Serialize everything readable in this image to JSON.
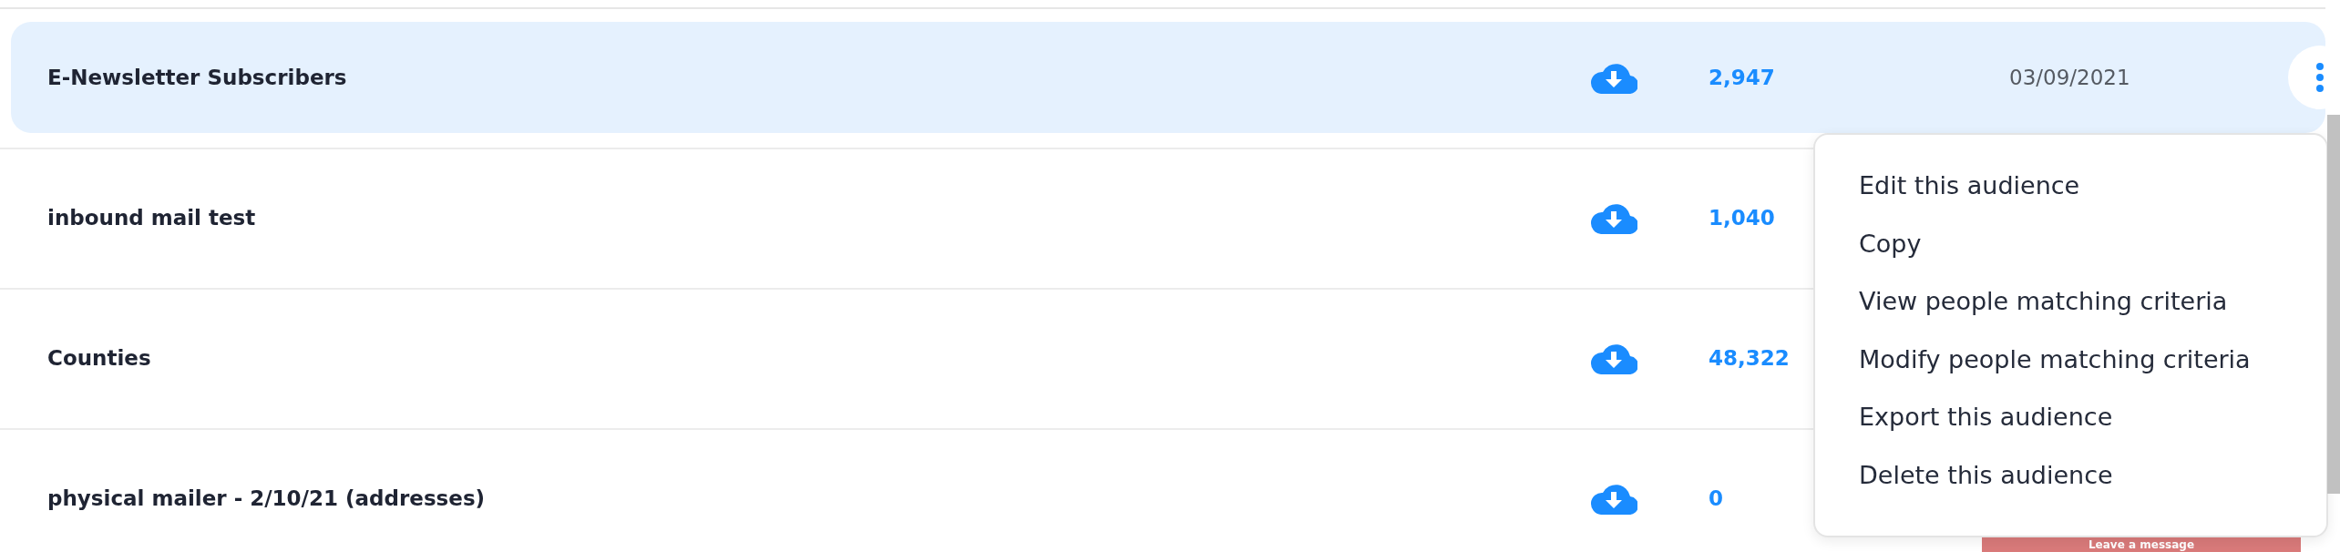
{
  "audiences": [
    {
      "name": "E-Newsletter Subscribers",
      "count": "2,947",
      "date": "03/09/2021",
      "selected": true
    },
    {
      "name": "inbound mail test",
      "count": "1,040",
      "selected": false
    },
    {
      "name": "Counties",
      "count": "48,322",
      "selected": false
    },
    {
      "name": "physical mailer - 2/10/21 (addresses)",
      "count": "0",
      "selected": false
    }
  ],
  "menu": {
    "items": [
      "Edit this audience",
      "Copy",
      "View people matching criteria",
      "Modify people matching criteria",
      "Export this audience",
      "Delete this audience"
    ]
  },
  "chat_button": {
    "label": "Leave a message"
  }
}
